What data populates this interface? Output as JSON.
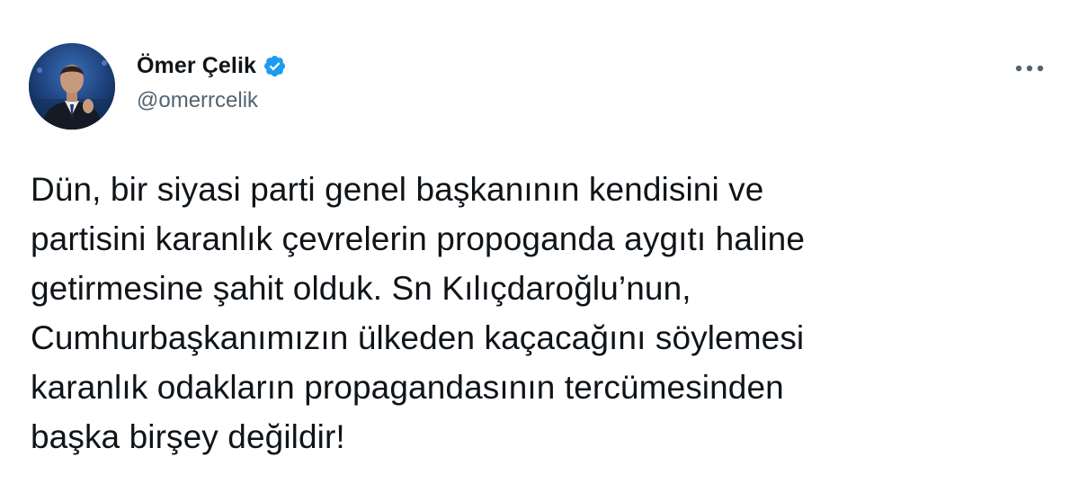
{
  "author": {
    "display_name": "Ömer Çelik",
    "handle": "@omerrcelik",
    "verified": true,
    "avatar_icon": "profile-photo"
  },
  "tweet": {
    "text": "Dün, bir siyasi parti genel başkanının kendisini ve\npartisini karanlık çevrelerin propoganda aygıtı haline\ngetirmesine şahit olduk. Sn Kılıçdaroğlu’nun,\nCumhurbaşkanımızın ülkeden kaçacağını söylemesi\nkaranlık odakların propagandasının tercümesinden\nbaşka birşey değildir!"
  },
  "icons": {
    "verified": "verified-badge-icon",
    "more": "more-options-icon"
  },
  "colors": {
    "text": "#0f1419",
    "secondary_text": "#536471",
    "verified_blue": "#1d9bf0",
    "background": "#ffffff"
  }
}
